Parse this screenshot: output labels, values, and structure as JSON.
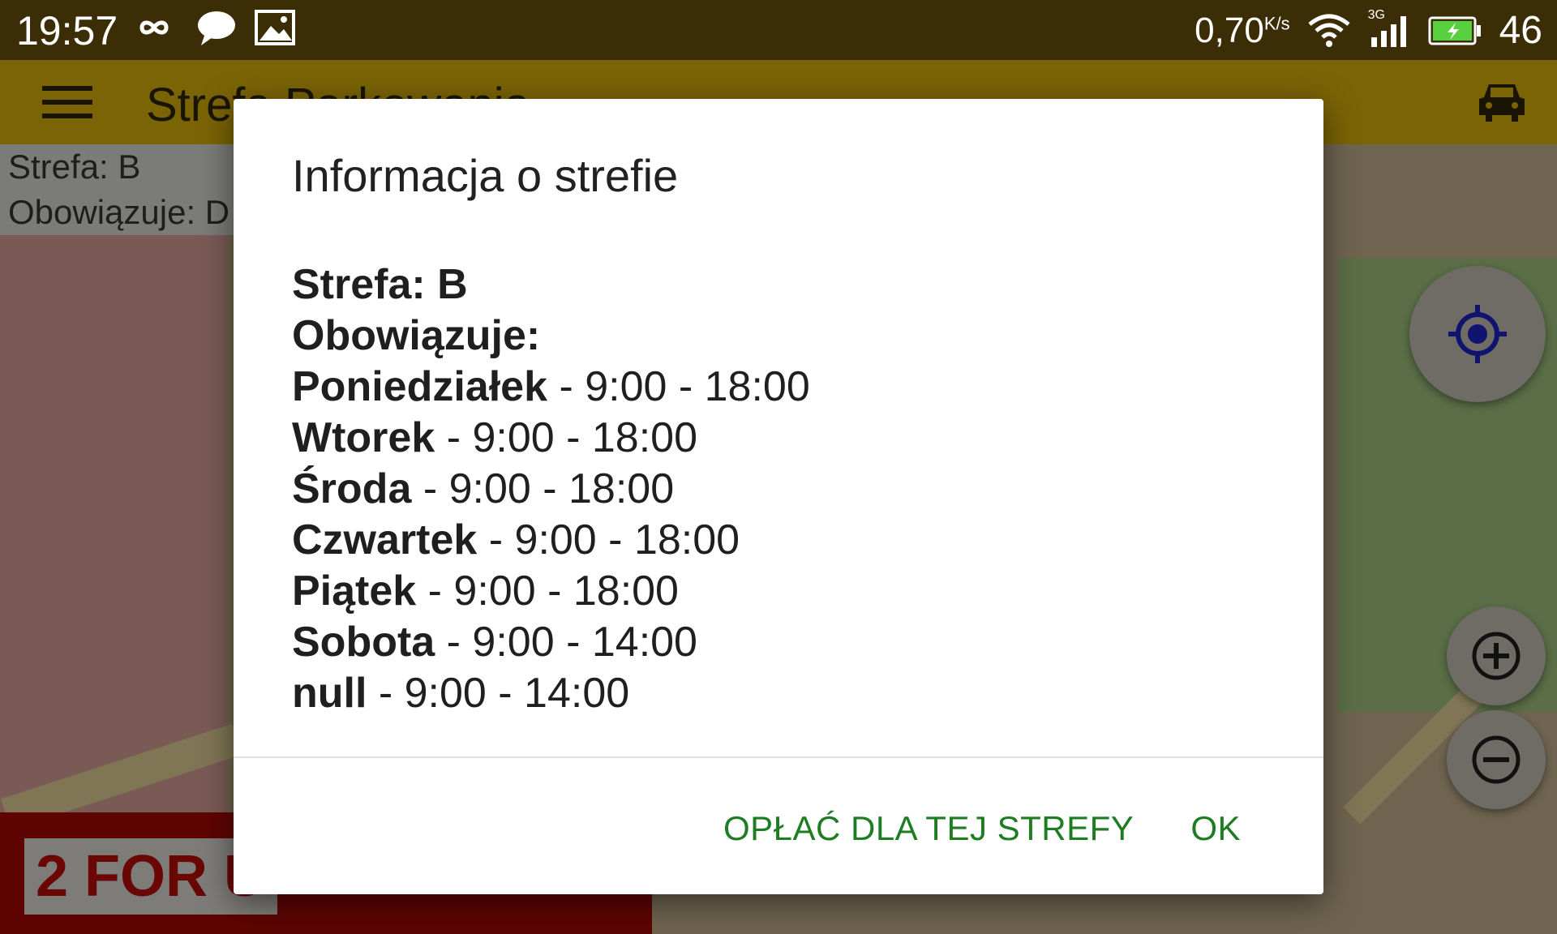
{
  "status_bar": {
    "time": "19:57",
    "speed": "0,70",
    "speed_unit": "K/s",
    "network": "3G",
    "battery": "46"
  },
  "app_bar": {
    "title": "Strefa Parkowania"
  },
  "zone_info": {
    "zone": "Strefa: B",
    "valid": "Obowiązuje: D"
  },
  "ad": {
    "text": "2 FOR U"
  },
  "dialog": {
    "title": "Informacja o strefie",
    "lines": [
      {
        "bold": "Strefa: B",
        "rest": ""
      },
      {
        "bold": "Obowiązuje:",
        "rest": ""
      },
      {
        "bold": "Poniedziałek",
        "rest": " - 9:00 - 18:00"
      },
      {
        "bold": "Wtorek",
        "rest": " - 9:00 - 18:00"
      },
      {
        "bold": "Środa",
        "rest": " - 9:00 - 18:00"
      },
      {
        "bold": "Czwartek",
        "rest": " - 9:00 - 18:00"
      },
      {
        "bold": "Piątek",
        "rest": " - 9:00 - 18:00"
      },
      {
        "bold": "Sobota",
        "rest": " - 9:00 - 14:00"
      },
      {
        "bold": "null",
        "rest": " - 9:00 - 14:00"
      }
    ],
    "pay_button": "OPŁAĆ DLA TEJ STREFY",
    "ok_button": "OK"
  },
  "colors": {
    "accent": "#1e7d22",
    "app_bar": "#7a6406"
  }
}
